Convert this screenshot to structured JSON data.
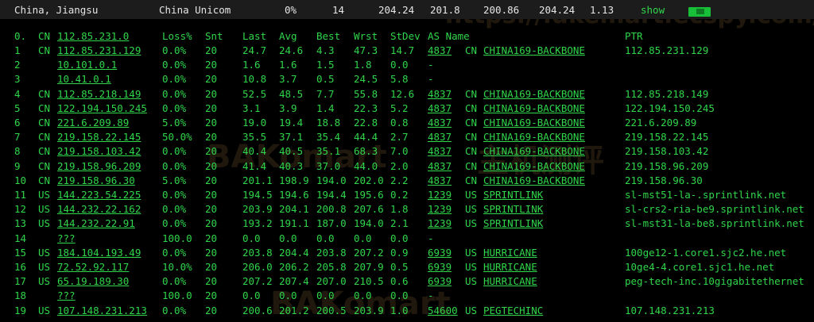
{
  "header": {
    "location": "China, Jiangsu",
    "isp": "China Unicom",
    "loss": "0%",
    "snt": "14",
    "last": "204.24",
    "avg": "201.8",
    "best": "200.86",
    "wrst": "204.24",
    "stdev": "1.13",
    "show_label": "show"
  },
  "watermark": {
    "url": "https://lukemart.ecspy.com/",
    "brand": "BAKomart",
    "cn": "主机测评"
  },
  "columns": {
    "num": "0.",
    "cc": "CN",
    "host": "112.85.231.0",
    "loss": "Loss%",
    "snt": "Snt",
    "last": "Last",
    "avg": "Avg",
    "best": "Best",
    "wrst": "Wrst",
    "stdev": "StDev",
    "as": "AS Name",
    "ptr": "PTR"
  },
  "rows": [
    {
      "num": "1",
      "cc": "CN",
      "host": "112.85.231.129",
      "loss": "0.0%",
      "snt": "20",
      "last": "24.7",
      "avg": "24.6",
      "best": "4.3",
      "wrst": "47.3",
      "stdev": "14.7",
      "asn": "4837",
      "ascc": "CN",
      "asname": "CHINA169-BACKBONE",
      "ptr": "112.85.231.129"
    },
    {
      "num": "2",
      "cc": "",
      "host": "10.101.0.1",
      "loss": "0.0%",
      "snt": "20",
      "last": "1.6",
      "avg": "1.6",
      "best": "1.5",
      "wrst": "1.8",
      "stdev": "0.0",
      "asn": "-",
      "ascc": "",
      "asname": "",
      "ptr": ""
    },
    {
      "num": "3",
      "cc": "",
      "host": "10.41.0.1",
      "loss": "0.0%",
      "snt": "20",
      "last": "10.8",
      "avg": "3.7",
      "best": "0.5",
      "wrst": "24.5",
      "stdev": "5.8",
      "asn": "-",
      "ascc": "",
      "asname": "",
      "ptr": ""
    },
    {
      "num": "4",
      "cc": "CN",
      "host": "112.85.218.149",
      "loss": "0.0%",
      "snt": "20",
      "last": "52.5",
      "avg": "48.5",
      "best": "7.7",
      "wrst": "55.8",
      "stdev": "12.6",
      "asn": "4837",
      "ascc": "CN",
      "asname": "CHINA169-BACKBONE",
      "ptr": "112.85.218.149"
    },
    {
      "num": "5",
      "cc": "CN",
      "host": "122.194.150.245",
      "loss": "0.0%",
      "snt": "20",
      "last": "3.1",
      "avg": "3.9",
      "best": "1.4",
      "wrst": "22.3",
      "stdev": "5.2",
      "asn": "4837",
      "ascc": "CN",
      "asname": "CHINA169-BACKBONE",
      "ptr": "122.194.150.245"
    },
    {
      "num": "6",
      "cc": "CN",
      "host": "221.6.209.89",
      "loss": "5.0%",
      "snt": "20",
      "last": "19.0",
      "avg": "19.4",
      "best": "18.8",
      "wrst": "22.8",
      "stdev": "0.8",
      "asn": "4837",
      "ascc": "CN",
      "asname": "CHINA169-BACKBONE",
      "ptr": "221.6.209.89"
    },
    {
      "num": "7",
      "cc": "CN",
      "host": "219.158.22.145",
      "loss": "50.0%",
      "snt": "20",
      "last": "35.5",
      "avg": "37.1",
      "best": "35.4",
      "wrst": "44.4",
      "stdev": "2.7",
      "asn": "4837",
      "ascc": "CN",
      "asname": "CHINA169-BACKBONE",
      "ptr": "219.158.22.145"
    },
    {
      "num": "8",
      "cc": "CN",
      "host": "219.158.103.42",
      "loss": "0.0%",
      "snt": "20",
      "last": "40.4",
      "avg": "40.5",
      "best": "35.1",
      "wrst": "68.3",
      "stdev": "7.0",
      "asn": "4837",
      "ascc": "CN",
      "asname": "CHINA169-BACKBONE",
      "ptr": "219.158.103.42"
    },
    {
      "num": "9",
      "cc": "CN",
      "host": "219.158.96.209",
      "loss": "0.0%",
      "snt": "20",
      "last": "41.4",
      "avg": "40.3",
      "best": "37.0",
      "wrst": "44.0",
      "stdev": "2.0",
      "asn": "4837",
      "ascc": "CN",
      "asname": "CHINA169-BACKBONE",
      "ptr": "219.158.96.209"
    },
    {
      "num": "10",
      "cc": "CN",
      "host": "219.158.96.30",
      "loss": "5.0%",
      "snt": "20",
      "last": "201.1",
      "avg": "198.9",
      "best": "194.0",
      "wrst": "202.0",
      "stdev": "2.2",
      "asn": "4837",
      "ascc": "CN",
      "asname": "CHINA169-BACKBONE",
      "ptr": "219.158.96.30"
    },
    {
      "num": "11",
      "cc": "US",
      "host": "144.223.54.225",
      "loss": "0.0%",
      "snt": "20",
      "last": "194.5",
      "avg": "194.6",
      "best": "194.4",
      "wrst": "195.6",
      "stdev": "0.2",
      "asn": "1239",
      "ascc": "US",
      "asname": "SPRINTLINK",
      "ptr": "sl-mst51-la-.sprintlink.net"
    },
    {
      "num": "12",
      "cc": "US",
      "host": "144.232.22.162",
      "loss": "0.0%",
      "snt": "20",
      "last": "203.9",
      "avg": "204.1",
      "best": "200.8",
      "wrst": "207.6",
      "stdev": "1.8",
      "asn": "1239",
      "ascc": "US",
      "asname": "SPRINTLINK",
      "ptr": "sl-crs2-ria-be9.sprintlink.net"
    },
    {
      "num": "13",
      "cc": "US",
      "host": "144.232.22.91",
      "loss": "0.0%",
      "snt": "20",
      "last": "193.2",
      "avg": "191.1",
      "best": "187.0",
      "wrst": "194.0",
      "stdev": "2.1",
      "asn": "1239",
      "ascc": "US",
      "asname": "SPRINTLINK",
      "ptr": "sl-mst31-la-be8.sprintlink.net"
    },
    {
      "num": "14",
      "cc": "",
      "host": "???",
      "loss": "100.0",
      "snt": "20",
      "last": "0.0",
      "avg": "0.0",
      "best": "0.0",
      "wrst": "0.0",
      "stdev": "0.0",
      "asn": "-",
      "ascc": "",
      "asname": "",
      "ptr": ""
    },
    {
      "num": "15",
      "cc": "US",
      "host": "184.104.193.49",
      "loss": "0.0%",
      "snt": "20",
      "last": "203.8",
      "avg": "204.4",
      "best": "203.8",
      "wrst": "207.2",
      "stdev": "0.9",
      "asn": "6939",
      "ascc": "US",
      "asname": "HURRICANE",
      "ptr": "100ge12-1.core1.sjc2.he.net"
    },
    {
      "num": "16",
      "cc": "US",
      "host": "72.52.92.117",
      "loss": "10.0%",
      "snt": "20",
      "last": "206.0",
      "avg": "206.2",
      "best": "205.8",
      "wrst": "207.9",
      "stdev": "0.5",
      "asn": "6939",
      "ascc": "US",
      "asname": "HURRICANE",
      "ptr": "10ge4-4.core1.sjc1.he.net"
    },
    {
      "num": "17",
      "cc": "US",
      "host": "65.19.189.30",
      "loss": "0.0%",
      "snt": "20",
      "last": "207.2",
      "avg": "207.4",
      "best": "207.0",
      "wrst": "210.5",
      "stdev": "0.6",
      "asn": "6939",
      "ascc": "US",
      "asname": "HURRICANE",
      "ptr": "peg-tech-inc.10gigabitethernet"
    },
    {
      "num": "18",
      "cc": "",
      "host": "???",
      "loss": "100.0",
      "snt": "20",
      "last": "0.0",
      "avg": "0.0",
      "best": "0.0",
      "wrst": "0.0",
      "stdev": "0.0",
      "asn": "-",
      "ascc": "",
      "asname": "",
      "ptr": ""
    },
    {
      "num": "19",
      "cc": "US",
      "host": "107.148.231.213",
      "loss": "0.0%",
      "snt": "20",
      "last": "200.6",
      "avg": "201.2",
      "best": "200.5",
      "wrst": "203.9",
      "stdev": "1.0",
      "asn": "54600",
      "ascc": "US",
      "asname": "PEGTECHINC",
      "ptr": "107.148.231.213"
    }
  ]
}
